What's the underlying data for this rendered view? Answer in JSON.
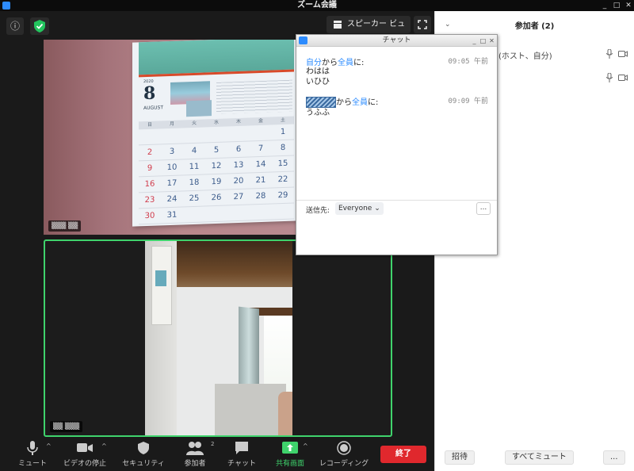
{
  "window": {
    "title": "ズーム会議",
    "controls": [
      "_",
      "□",
      "✕"
    ]
  },
  "meeting": {
    "speaker_view_label": "スピーカー ビュー",
    "info_icon": "info-icon",
    "security_icon": "shield-check-icon"
  },
  "toolbar": {
    "items": [
      {
        "label": "ミュート",
        "icon": "microphone-icon"
      },
      {
        "label": "ビデオの停止",
        "icon": "video-camera-icon"
      },
      {
        "label": "セキュリティ",
        "icon": "shield-icon"
      },
      {
        "label": "参加者",
        "icon": "participants-icon",
        "badge": "2"
      },
      {
        "label": "チャット",
        "icon": "chat-bubble-icon"
      },
      {
        "label": "共有画面",
        "icon": "share-screen-icon"
      },
      {
        "label": "レコーディング",
        "icon": "record-icon"
      }
    ],
    "end_label": "終了",
    "accent": "#3fd36c",
    "end_color": "#e0282d"
  },
  "calendar": {
    "year": "2020",
    "month_number": "8",
    "month_name": "AUGUST",
    "weekdays": [
      "日",
      "月",
      "火",
      "水",
      "木",
      "金",
      "土"
    ],
    "weeks": [
      [
        "",
        "",
        "",
        "",
        "",
        "",
        "1"
      ],
      [
        "2",
        "3",
        "4",
        "5",
        "6",
        "7",
        "8"
      ],
      [
        "9",
        "10",
        "11",
        "12",
        "13",
        "14",
        "15"
      ],
      [
        "16",
        "17",
        "18",
        "19",
        "20",
        "21",
        "22"
      ],
      [
        "23",
        "24",
        "25",
        "26",
        "27",
        "28",
        "29"
      ],
      [
        "30",
        "31",
        "",
        "",
        "",
        "",
        ""
      ]
    ]
  },
  "participants": {
    "title": "参加者 (2)",
    "rows": [
      {
        "name": "(ホスト、自分)"
      },
      {
        "name": ""
      }
    ],
    "invite_label": "招待",
    "mute_all_label": "すべてミュート",
    "more_label": "..."
  },
  "chat": {
    "title": "チャット",
    "messages": [
      {
        "sender": "自分",
        "from": "から",
        "to": "全員",
        "suffix": "に:",
        "time": "09:05 午前",
        "lines": [
          "わはは",
          "いひひ"
        ]
      },
      {
        "sender": "",
        "from": "から",
        "to": "全員",
        "suffix": "に:",
        "time": "09:09 午前",
        "lines": [
          "うふふ"
        ]
      }
    ],
    "send_to_label": "送信先:",
    "send_to_value": "Everyone",
    "more_label": "..."
  }
}
